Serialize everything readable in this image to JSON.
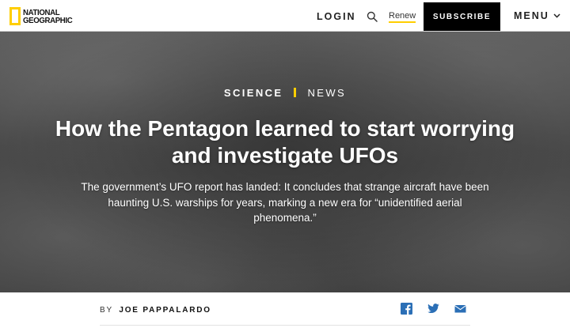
{
  "header": {
    "logo": {
      "line1": "NATIONAL",
      "line2": "GEOGRAPHIC",
      "frame_color": "#ffce00"
    },
    "login_label": "LOGIN",
    "renew_label": "Renew",
    "subscribe_label": "SUBSCRIBE",
    "menu_label": "MENU",
    "icons": [
      "search-icon",
      "chevron-down-icon"
    ]
  },
  "article": {
    "kicker": {
      "section": "SCIENCE",
      "type": "NEWS",
      "accent_color": "#ffce00"
    },
    "headline": "How the Pentagon learned to start worrying and investigate UFOs",
    "dek": "The government’s UFO report has landed: It concludes that strange aircraft have been haunting U.S. warships for years, marking a new era for “unidentified aerial phenomena.”",
    "byline": {
      "prefix": "BY",
      "author": "JOE PAPPALARDO"
    },
    "share": [
      "facebook-icon",
      "twitter-icon",
      "email-icon"
    ],
    "share_color": "#2b6fb6"
  }
}
